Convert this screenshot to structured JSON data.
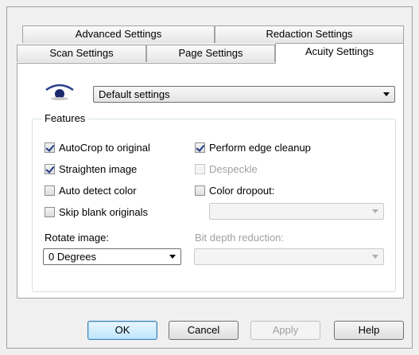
{
  "tabs_row1": [
    {
      "label": "Advanced Settings"
    },
    {
      "label": "Redaction Settings"
    }
  ],
  "tabs_row2": [
    {
      "label": "Scan Settings"
    },
    {
      "label": "Page Settings"
    },
    {
      "label": "Acuity Settings",
      "selected": true
    }
  ],
  "preset": {
    "value": "Default settings",
    "icon": "eye-icon"
  },
  "features": {
    "legend": "Features",
    "autocrop": {
      "label": "AutoCrop to original",
      "checked": true
    },
    "straighten": {
      "label": "Straighten image",
      "checked": true
    },
    "auto_detect_color": {
      "label": "Auto detect color",
      "checked": false
    },
    "skip_blank": {
      "label": "Skip blank originals",
      "checked": false
    },
    "edge_cleanup": {
      "label": "Perform edge cleanup",
      "checked": true
    },
    "despeckle": {
      "label": "Despeckle",
      "checked": false,
      "disabled": true
    },
    "color_dropout": {
      "label": "Color dropout:",
      "checked": false
    },
    "color_dropout_select": {
      "value": "",
      "disabled": true
    },
    "rotate_label": "Rotate image:",
    "rotate_select": {
      "value": "0 Degrees"
    },
    "bit_depth_label": "Bit depth reduction:",
    "bit_depth_select": {
      "value": "",
      "disabled": true
    }
  },
  "buttons": {
    "ok": "OK",
    "cancel": "Cancel",
    "apply": "Apply",
    "help": "Help"
  },
  "colors": {
    "accent": "#3c7fb1",
    "check": "#1f3a8a"
  }
}
